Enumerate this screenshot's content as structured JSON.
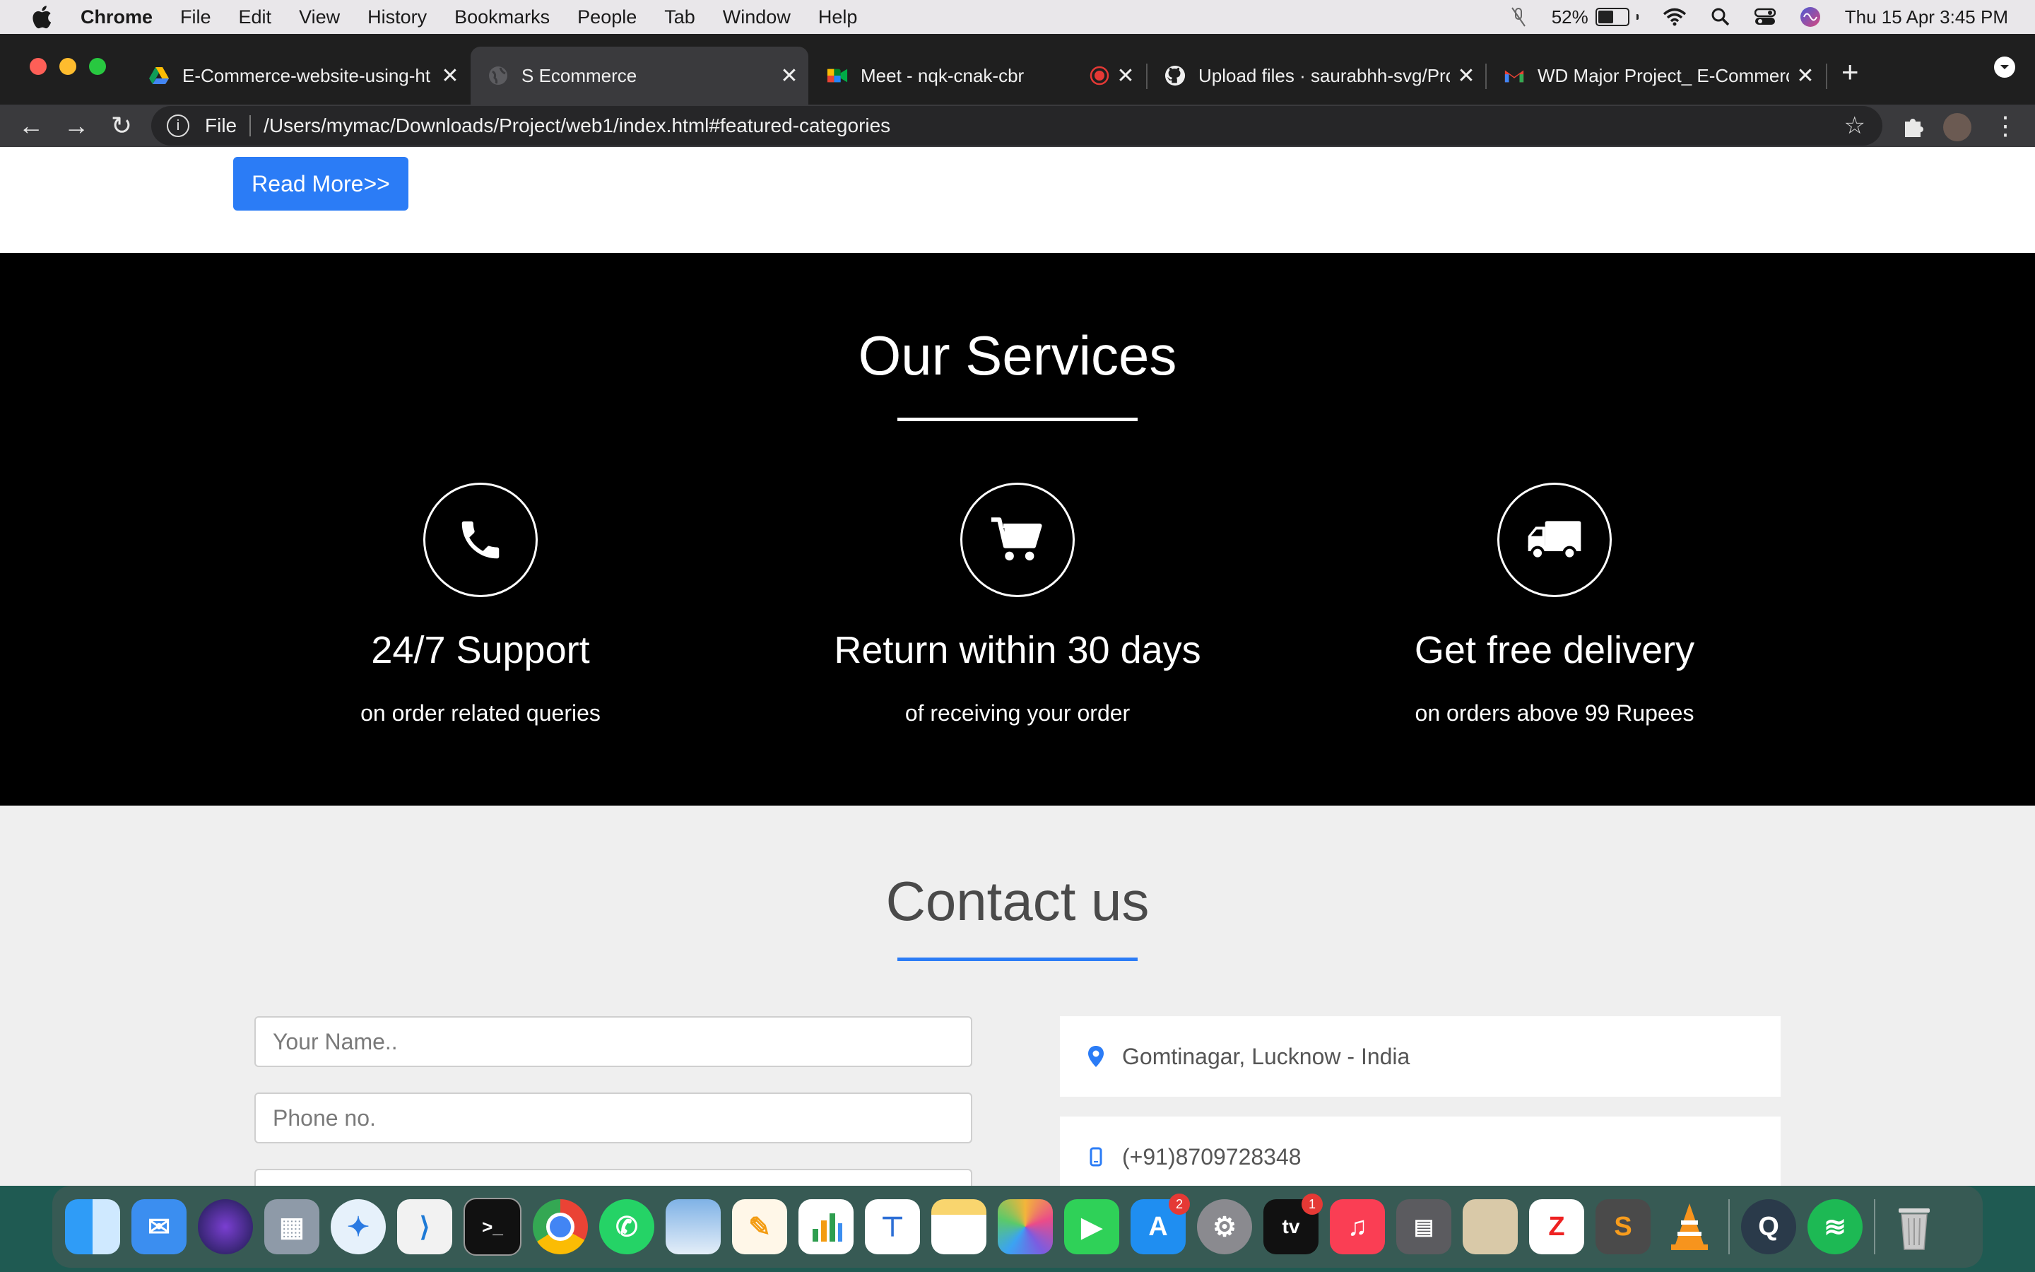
{
  "menubar": {
    "app_name": "Chrome",
    "items": [
      "File",
      "Edit",
      "View",
      "History",
      "Bookmarks",
      "People",
      "Tab",
      "Window",
      "Help"
    ],
    "battery_percent": "52%",
    "battery_level": 0.52,
    "datetime": "Thu 15 Apr  3:45 PM"
  },
  "tabs": [
    {
      "title": "E-Commerce-website-using-ht",
      "favicon": "google-drive-icon"
    },
    {
      "title": "S Ecommerce",
      "favicon": "globe-icon"
    },
    {
      "title": "Meet - nqk-cnak-cbr",
      "favicon": "google-meet-icon"
    },
    {
      "title": "Upload files · saurabhh-svg/Pro",
      "favicon": "github-icon"
    },
    {
      "title": "WD Major Project_ E-Commerc",
      "favicon": "gmail-icon"
    }
  ],
  "omnibox": {
    "scheme": "File",
    "url": "/Users/mymac/Downloads/Project/web1/index.html#featured-categories"
  },
  "page": {
    "read_more": "Read More>>",
    "services": {
      "title": "Our Services",
      "items": [
        {
          "icon": "phone-icon",
          "title": "24/7 Support",
          "text": "on order related queries"
        },
        {
          "icon": "cart-icon",
          "title": "Return within 30 days",
          "text": "of receiving your order"
        },
        {
          "icon": "truck-icon",
          "title": "Get free delivery",
          "text": "on orders above 99 Rupees"
        }
      ]
    },
    "contact": {
      "title": "Contact us",
      "name_placeholder": "Your Name..",
      "phone_placeholder": "Phone no.",
      "address": "Gomtinagar, Lucknow - India",
      "phone": "(+91)8709728348"
    }
  },
  "dock": {
    "apps": [
      "Finder",
      "Mail",
      "Siri",
      "Launchpad",
      "Safari",
      "Visual Studio Code",
      "Terminal",
      "Chrome",
      "WhatsApp",
      "Preview",
      "Pages",
      "Numbers",
      "Keynote",
      "Notes",
      "Photos",
      "FaceTime",
      "App Store",
      "System Preferences",
      "TV",
      "Music",
      "Calculator",
      "Dictionary",
      "PhotoBooth",
      "Sublime Text",
      "VLC",
      "QuickTime",
      "Spotify",
      "Trash"
    ],
    "app_store_badge": "2",
    "tv_badge": "1"
  },
  "colors": {
    "accent_blue": "#2b7cf6",
    "services_bg": "#000000",
    "contact_bg": "#efefef"
  }
}
